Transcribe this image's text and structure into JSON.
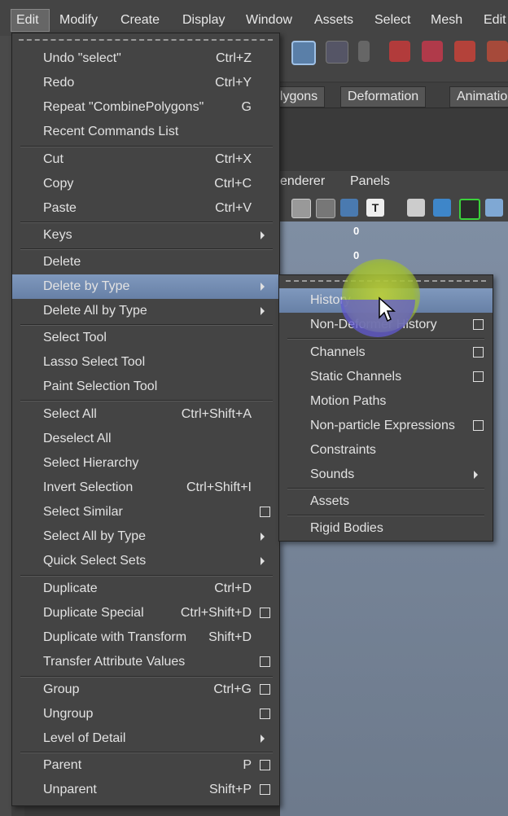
{
  "menubar": {
    "items": [
      "Edit",
      "Modify",
      "Create",
      "Display",
      "Window",
      "Assets",
      "Select",
      "Mesh",
      "Edit"
    ]
  },
  "shelf_tabs": [
    "olygons",
    "Deformation",
    "Animatio"
  ],
  "viewport_menu": [
    "enderer",
    "Panels"
  ],
  "viewport_hud": [
    "0",
    "0"
  ],
  "edit_menu": {
    "items": [
      {
        "label": "Undo \"select\"",
        "shortcut": "Ctrl+Z"
      },
      {
        "label": "Redo",
        "shortcut": "Ctrl+Y"
      },
      {
        "label": "Repeat \"CombinePolygons\"",
        "shortcut": "G"
      },
      {
        "label": "Recent Commands List",
        "shortcut": ""
      },
      {
        "label": "Cut",
        "shortcut": "Ctrl+X"
      },
      {
        "label": "Copy",
        "shortcut": "Ctrl+C"
      },
      {
        "label": "Paste",
        "shortcut": "Ctrl+V"
      },
      {
        "label": "Keys",
        "shortcut": ""
      },
      {
        "label": "Delete",
        "shortcut": ""
      },
      {
        "label": "Delete by Type",
        "shortcut": ""
      },
      {
        "label": "Delete All by Type",
        "shortcut": ""
      },
      {
        "label": "Select Tool",
        "shortcut": ""
      },
      {
        "label": "Lasso Select Tool",
        "shortcut": ""
      },
      {
        "label": "Paint Selection Tool",
        "shortcut": ""
      },
      {
        "label": "Select All",
        "shortcut": "Ctrl+Shift+A"
      },
      {
        "label": "Deselect All",
        "shortcut": ""
      },
      {
        "label": "Select Hierarchy",
        "shortcut": ""
      },
      {
        "label": "Invert Selection",
        "shortcut": "Ctrl+Shift+I"
      },
      {
        "label": "Select Similar",
        "shortcut": ""
      },
      {
        "label": "Select All by Type",
        "shortcut": ""
      },
      {
        "label": "Quick Select Sets",
        "shortcut": ""
      },
      {
        "label": "Duplicate",
        "shortcut": "Ctrl+D"
      },
      {
        "label": "Duplicate Special",
        "shortcut": "Ctrl+Shift+D"
      },
      {
        "label": "Duplicate with Transform",
        "shortcut": "Shift+D"
      },
      {
        "label": "Transfer Attribute Values",
        "shortcut": ""
      },
      {
        "label": "Group",
        "shortcut": "Ctrl+G"
      },
      {
        "label": "Ungroup",
        "shortcut": ""
      },
      {
        "label": "Level of Detail",
        "shortcut": ""
      },
      {
        "label": "Parent",
        "shortcut": "P"
      },
      {
        "label": "Unparent",
        "shortcut": "Shift+P"
      }
    ]
  },
  "delete_by_type_menu": {
    "items": [
      {
        "label": "History"
      },
      {
        "label": "Non-Deformer History"
      },
      {
        "label": "Channels"
      },
      {
        "label": "Static Channels"
      },
      {
        "label": "Motion Paths"
      },
      {
        "label": "Non-particle Expressions"
      },
      {
        "label": "Constraints"
      },
      {
        "label": "Sounds"
      },
      {
        "label": "Assets"
      },
      {
        "label": "Rigid Bodies"
      }
    ]
  },
  "colors": {
    "menu_bg": "#444444",
    "highlight": "#7089b0",
    "viewport": "#7a889c"
  }
}
